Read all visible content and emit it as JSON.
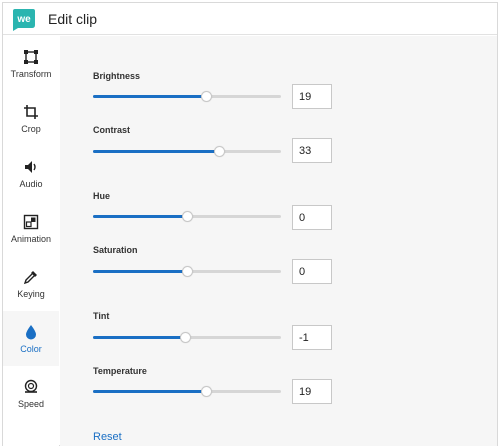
{
  "header": {
    "title": "Edit clip",
    "logo_text": "we",
    "logo_color": "#2bb5b0"
  },
  "sidebar": {
    "items": [
      {
        "label": "Transform",
        "icon": "transform-icon",
        "active": false
      },
      {
        "label": "Crop",
        "icon": "crop-icon",
        "active": false
      },
      {
        "label": "Audio",
        "icon": "speaker-icon",
        "active": false
      },
      {
        "label": "Animation",
        "icon": "animation-icon",
        "active": false
      },
      {
        "label": "Keying",
        "icon": "eyedropper-icon",
        "active": false
      },
      {
        "label": "Color",
        "icon": "droplet-icon",
        "active": true
      },
      {
        "label": "Speed",
        "icon": "speed-icon",
        "active": false
      }
    ]
  },
  "controls": [
    {
      "label": "Brightness",
      "value": "19",
      "fraction": 0.6
    },
    {
      "label": "Contrast",
      "value": "33",
      "fraction": 0.67
    },
    {
      "label": "Hue",
      "value": "0",
      "fraction": 0.5
    },
    {
      "label": "Saturation",
      "value": "0",
      "fraction": 0.5
    },
    {
      "label": "Tint",
      "value": "-1",
      "fraction": 0.49
    },
    {
      "label": "Temperature",
      "value": "19",
      "fraction": 0.6
    }
  ],
  "reset_label": "Reset",
  "colors": {
    "accent": "#1a6fc4",
    "panel_bg": "#f6f6f6"
  }
}
